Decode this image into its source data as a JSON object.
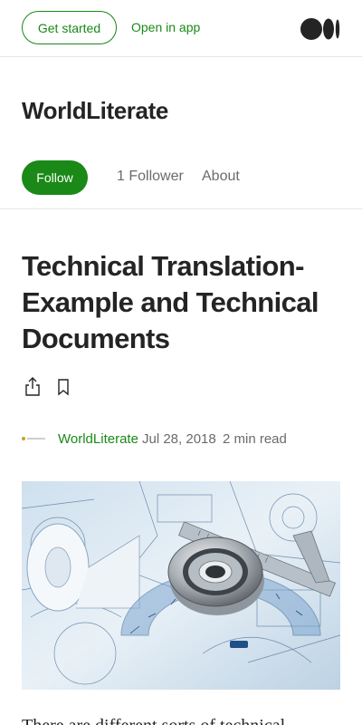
{
  "header": {
    "get_started_label": "Get started",
    "open_in_app_label": "Open in app",
    "logo_icon": "medium-logo-icon"
  },
  "publication": {
    "name": "WorldLiterate",
    "follow_label": "Follow",
    "followers_label": "1 Follower",
    "about_label": "About"
  },
  "article": {
    "title": "Technical Translation-Example and Technical Documents",
    "author": "WorldLiterate",
    "date": "Jul 28, 2018",
    "separator": "·",
    "read_time": "2 min read",
    "body_start": "There are different sorts of technical"
  },
  "colors": {
    "accent": "#1a8917",
    "text": "#242424",
    "muted": "#6b6b6b",
    "divider": "#e6e6e6"
  }
}
